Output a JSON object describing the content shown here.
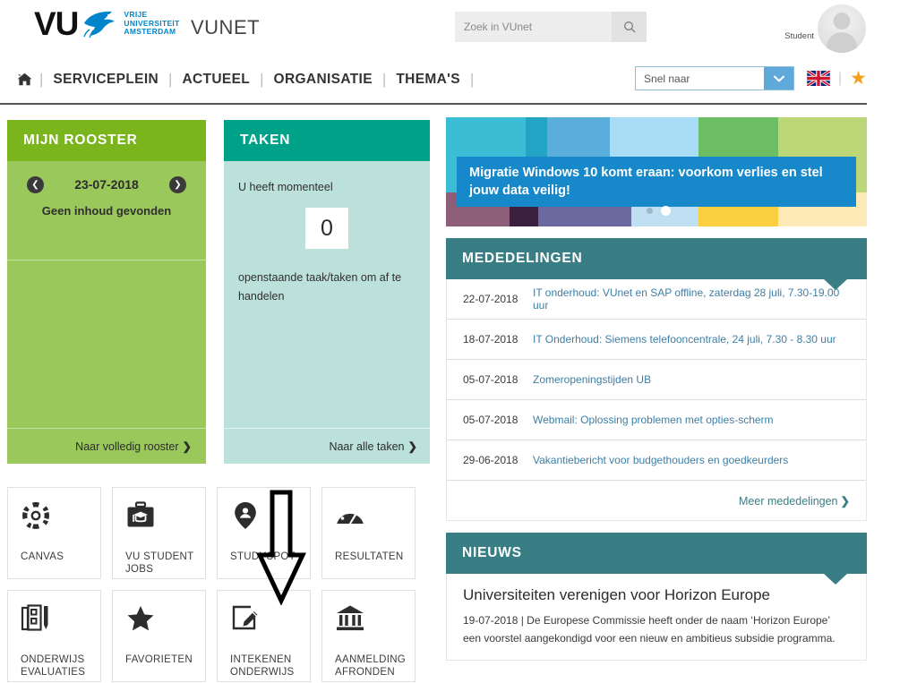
{
  "header": {
    "logo_text": "VU",
    "logo_words": [
      "VRIJE",
      "UNIVERSITEIT",
      "AMSTERDAM"
    ],
    "site_title": "VUNET",
    "search": {
      "placeholder": "Zoek in VUnet",
      "value": "",
      "icon": "search-icon"
    },
    "user": {
      "name": "Student",
      "avatar_icon": "user-avatar-icon"
    }
  },
  "nav": {
    "home_icon": "home-icon",
    "items": [
      "SERVICEPLEIN",
      "ACTUEEL",
      "ORGANISATIE",
      "THEMA'S"
    ],
    "separator": "|",
    "quicknav": {
      "label": "Snel naar",
      "icon": "chevron-down-icon"
    },
    "language_flag": "uk-flag-icon",
    "favorites_icon": "star-icon"
  },
  "rooster": {
    "title": "MIJN ROOSTER",
    "prev_icon": "chevron-left-icon",
    "next_icon": "chevron-right-icon",
    "date": "23-07-2018",
    "empty_message": "Geen inhoud gevonden",
    "footer_link": "Naar volledig rooster",
    "footer_chevron": "❯",
    "header_color": "#7AB51D",
    "body_color": "#9BC85B"
  },
  "taken": {
    "title": "TAKEN",
    "line1": "U heeft momenteel",
    "count": "0",
    "line2": "openstaande taak/taken om af te handelen",
    "footer_link": "Naar alle taken",
    "footer_chevron": "❯",
    "header_color": "#00A189",
    "body_color": "#BCE0DA",
    "annotation_arrow": "down-arrow-annotation"
  },
  "tiles": [
    {
      "label": "CANVAS",
      "icon": "canvas-icon"
    },
    {
      "label": "VU STUDENT JOBS",
      "icon": "briefcase-graduation-icon"
    },
    {
      "label": "STUDYSPOT",
      "icon": "map-pin-person-icon"
    },
    {
      "label": "RESULTATEN",
      "icon": "gauge-icon"
    },
    {
      "label": "ONDERWIJS EVALUATIES",
      "icon": "survey-pencil-icon"
    },
    {
      "label": "FAVORIETEN",
      "icon": "star-filled-icon"
    },
    {
      "label": "INTEKENEN ONDERWIJS",
      "icon": "edit-square-icon"
    },
    {
      "label": "AANMELDING AFRONDEN",
      "icon": "bank-building-icon"
    }
  ],
  "banner": {
    "text": "Migratie Windows 10 komt eraan: voorkom verlies en stel jouw data veilig!",
    "overlay_color": "#1789CA",
    "mosaic_top": [
      "#3BBDD6",
      "#22A4C4",
      "#5AAEDC",
      "#A9DCF5",
      "#6BBE63",
      "#BBD777"
    ],
    "mosaic_bottom": [
      "#8C5E78",
      "#3A1F3F",
      "#6A6AA0",
      "#BFE0F2",
      "#FBCF3F",
      "#FCE9B6"
    ],
    "dots": [
      "inactive",
      "active"
    ]
  },
  "mededelingen": {
    "title": "MEDEDELINGEN",
    "items": [
      {
        "date": "22-07-2018",
        "text": "IT onderhoud: VUnet en SAP offline, zaterdag 28 juli, 7.30-19.00 uur"
      },
      {
        "date": "18-07-2018",
        "text": "IT Onderhoud: Siemens telefooncentrale, 24 juli, 7.30 - 8.30 uur"
      },
      {
        "date": "05-07-2018",
        "text": "Zomeropeningstijden UB"
      },
      {
        "date": "05-07-2018",
        "text": "Webmail: Oplossing problemen met opties-scherm"
      },
      {
        "date": "29-06-2018",
        "text": "Vakantiebericht voor budgethouders en goedkeurders"
      }
    ],
    "footer_link": "Meer mededelingen",
    "footer_chevron": "❯",
    "header_color": "#3A7E85"
  },
  "nieuws": {
    "title": "NIEUWS",
    "headline": "Universiteiten verenigen voor Horizon Europe",
    "body": "19-07-2018 | De Europese Commissie heeft onder de naam ‘Horizon Europe’ een voorstel aangekondigd voor een nieuw en ambitieus subsidie programma.",
    "header_color": "#3A7E85"
  }
}
